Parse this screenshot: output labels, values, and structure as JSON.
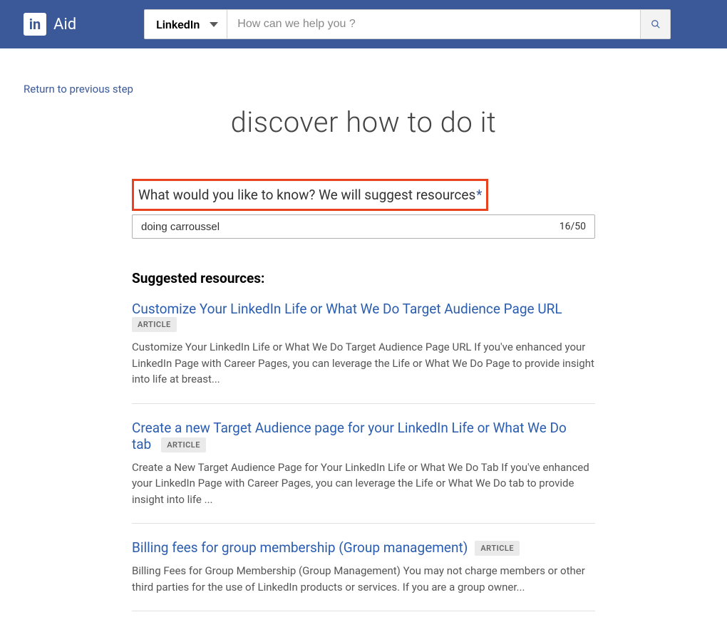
{
  "header": {
    "logo_letters": "in",
    "brand": "Aid",
    "dropdown_label": "LinkedIn",
    "search_placeholder": "How can we help you ?"
  },
  "nav": {
    "return_link": "Return to previous step"
  },
  "page": {
    "title": "discover how to do it",
    "question_label": "What would you like to know? We will suggest resources",
    "required_mark": "*",
    "query_value": "doing carroussel",
    "char_counter": "16/50",
    "suggested_heading": "Suggested resources:"
  },
  "results": [
    {
      "title": "Customize Your LinkedIn Life or What We Do Target Audience Page URL",
      "badge": "ARTICLE",
      "desc": "Customize Your LinkedIn Life or What We Do Target Audience Page URL If you've enhanced your LinkedIn Page with Career Pages, you can leverage the Life or What We Do Page to provide insight into life at breast..."
    },
    {
      "title": "Create a new Target Audience page for your LinkedIn Life or What We Do tab",
      "badge": "ARTICLE",
      "desc": "Create a New Target Audience Page for Your LinkedIn Life or What We Do Tab If you've enhanced your LinkedIn Page with Career Pages, you can leverage the Life or What We Do tab to provide insight into life ..."
    },
    {
      "title": "Billing fees for group membership (Group management)",
      "badge": "ARTICLE",
      "desc": "Billing Fees for Group Membership (Group Management) You may not charge members or other third parties for the use of LinkedIn products or services. If you are a group owner..."
    }
  ]
}
